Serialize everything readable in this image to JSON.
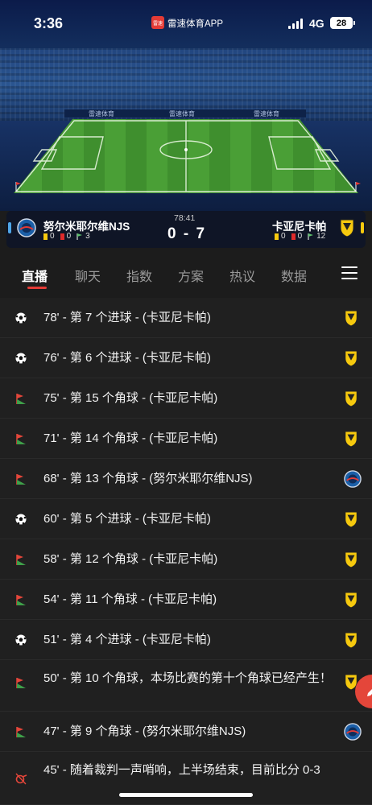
{
  "status_bar": {
    "time": "3:36",
    "app_badge": "雷速",
    "app_name": "雷速体育APP",
    "network": "4G",
    "battery": "28"
  },
  "stadium": {
    "ad_text": "雷速体育"
  },
  "match": {
    "home": {
      "name": "努尔米耶尔维NJS",
      "yellow": "0",
      "red": "0",
      "corners": "3",
      "color": "#4fa6e8"
    },
    "away": {
      "name": "卡亚尼卡帕",
      "yellow": "0",
      "red": "0",
      "corners": "12",
      "color": "#f6c90e"
    },
    "minute": "78:41",
    "score": "0 - 7"
  },
  "tabs": [
    "直播",
    "聊天",
    "指数",
    "方案",
    "热议",
    "数据"
  ],
  "events": [
    {
      "icon": "ball-icon",
      "text": "78' - 第 7 个进球 - (卡亚尼卡帕)",
      "team": "away"
    },
    {
      "icon": "ball-icon",
      "text": "76' - 第 6 个进球 - (卡亚尼卡帕)",
      "team": "away"
    },
    {
      "icon": "corner-flag-icon",
      "text": "75' - 第 15 个角球 - (卡亚尼卡帕)",
      "team": "away"
    },
    {
      "icon": "corner-flag-icon",
      "text": "71' - 第 14 个角球 - (卡亚尼卡帕)",
      "team": "away"
    },
    {
      "icon": "corner-flag-icon",
      "text": "68' - 第 13 个角球 - (努尔米耶尔维NJS)",
      "team": "home"
    },
    {
      "icon": "ball-icon",
      "text": "60' - 第 5 个进球 - (卡亚尼卡帕)",
      "team": "away"
    },
    {
      "icon": "corner-flag-icon",
      "text": "58' - 第 12 个角球 - (卡亚尼卡帕)",
      "team": "away"
    },
    {
      "icon": "corner-flag-icon",
      "text": "54' - 第 11 个角球 - (卡亚尼卡帕)",
      "team": "away"
    },
    {
      "icon": "ball-icon",
      "text": "51' - 第 4 个进球 - (卡亚尼卡帕)",
      "team": "away"
    },
    {
      "icon": "corner-flag-icon",
      "text": "50' - 第 10 个角球，本场比赛的第十个角球已经产生！",
      "team": "away"
    },
    {
      "icon": "corner-flag-icon",
      "text": "47' - 第 9 个角球 - (努尔米耶尔维NJS)",
      "team": "home"
    },
    {
      "icon": "whistle-icon",
      "text": "45' - 随着裁判一声哨响，上半场结束，目前比分 0-3",
      "team": ""
    }
  ]
}
